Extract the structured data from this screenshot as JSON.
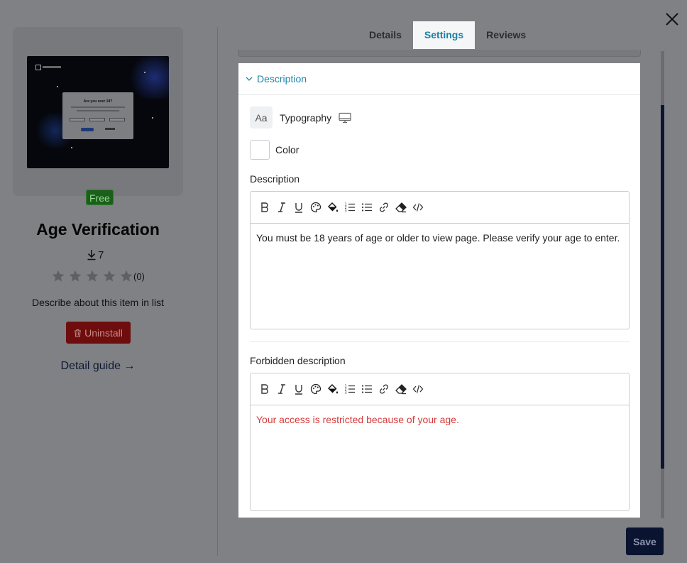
{
  "app": {
    "title": "Age Verification",
    "badge": "Free",
    "downloads": "7",
    "rating_count": "(0)",
    "description": "Describe about this item in list",
    "uninstall_label": "Uninstall",
    "detail_guide_label": "Detail guide →",
    "thumbnail": {
      "modal_title": "Are you over 18?"
    }
  },
  "tabs": [
    {
      "label": "Details",
      "active": false
    },
    {
      "label": "Settings",
      "active": true
    },
    {
      "label": "Reviews",
      "active": false
    }
  ],
  "section": {
    "title": "Description",
    "typography_label": "Typography",
    "typography_icon_text": "Aa",
    "color_label": "Color",
    "description_label": "Description",
    "description_value": "You must be 18 years of age or older to view page. Please verify your age to enter.",
    "forbidden_label": "Forbidden description",
    "forbidden_value": "Your access is restricted because of your age.",
    "forbidden_color": "#d63a3a"
  },
  "toolbar_icons": [
    "bold-icon",
    "italic-icon",
    "underline-icon",
    "palette-icon",
    "fill-color-icon",
    "ordered-list-icon",
    "bullet-list-icon",
    "link-icon",
    "eraser-icon",
    "code-icon"
  ],
  "footer": {
    "save_label": "Save"
  },
  "colors": {
    "accent": "#1f86a8",
    "save_bg": "#0a1430",
    "uninstall_bg": "#6e0d0d",
    "free_bg": "#1c5f1c"
  }
}
